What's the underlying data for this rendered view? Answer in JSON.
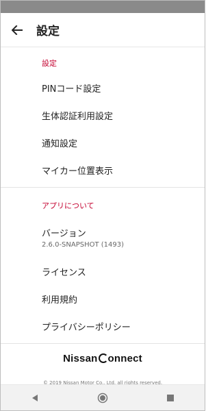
{
  "app_bar": {
    "title": "設定",
    "back_icon": "arrow-left-icon"
  },
  "sections": [
    {
      "header": "設定",
      "items": [
        {
          "label": "PINコード設定"
        },
        {
          "label": "生体認証利用設定"
        },
        {
          "label": "通知設定"
        },
        {
          "label": "マイカー位置表示"
        }
      ]
    },
    {
      "header": "アプリについて",
      "version": {
        "label": "バージョン",
        "value": "2.6.0-SNAPSHOT (1493)"
      },
      "items": [
        {
          "label": "ライセンス"
        },
        {
          "label": "利用規約"
        },
        {
          "label": "プライバシーポリシー"
        }
      ]
    }
  ],
  "footer": {
    "brand_prefix": "Nissan",
    "brand_suffix": "onnect",
    "copyright": "© 2019 Nissan Motor Co., Ltd. all rights reserved."
  },
  "nav_bar": {
    "back_icon": "triangle-back-icon",
    "home_icon": "circle-home-icon",
    "recents_icon": "square-recents-icon"
  },
  "colors": {
    "accent": "#c3002f",
    "status_bar": "#8a8a8a"
  }
}
